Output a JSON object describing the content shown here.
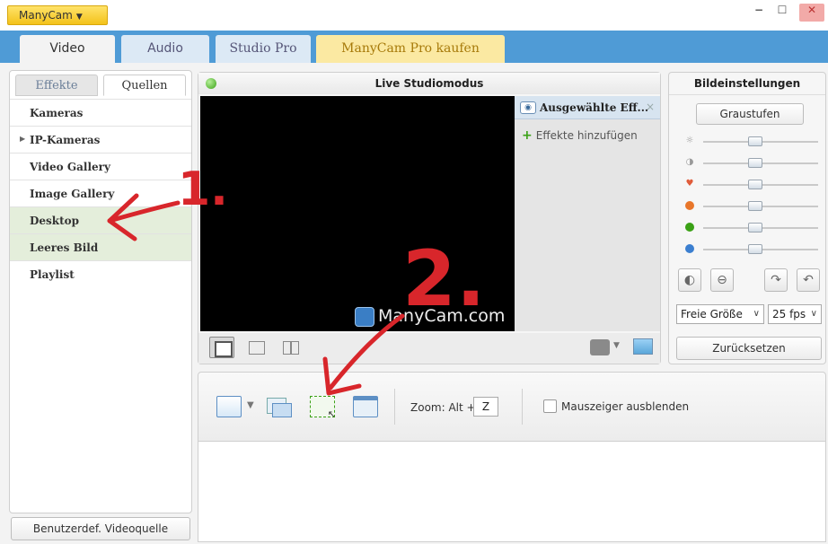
{
  "app": {
    "menu_label": "ManyCam",
    "window_controls": {
      "minimize": "−",
      "maximize": "☐",
      "close": "✕"
    }
  },
  "main_tabs": [
    {
      "label": "Video"
    },
    {
      "label": "Audio"
    },
    {
      "label": "Studio Pro"
    },
    {
      "label": "ManyCam Pro kaufen"
    }
  ],
  "left_panel": {
    "subtabs": [
      {
        "label": "Effekte"
      },
      {
        "label": "Quellen"
      }
    ],
    "items": [
      {
        "label": "Kameras"
      },
      {
        "label": "IP-Kameras"
      },
      {
        "label": "Video Gallery"
      },
      {
        "label": "Image Gallery"
      },
      {
        "label": "Desktop"
      },
      {
        "label": "Leeres Bild"
      },
      {
        "label": "Playlist"
      }
    ],
    "custom_source_button": "Benutzerdef. Videoquelle"
  },
  "live_panel": {
    "title": "Live Studiomodus",
    "watermark": "ManyCam.com",
    "effects_header": "Ausgewählte Eff...",
    "effects_close": "×",
    "add_effects": "Effekte hinzufügen",
    "add_symbol": "+"
  },
  "settings_panel": {
    "title": "Bildeinstellungen",
    "grayscale_button": "Graustufen",
    "size_select": "Freie Größe",
    "fps_select": "25 fps",
    "reset_button": "Zurücksetzen",
    "slider_colors": [
      "#b5b5b5",
      "#b5b5b5",
      "#e05c3a",
      "#e8762a",
      "#3aa116",
      "#3b7fd0"
    ]
  },
  "desktop_toolbar": {
    "zoom_label": "Zoom: Alt +",
    "zoom_key": "Z",
    "hide_cursor_label": "Mauszeiger ausblenden"
  },
  "annotations": {
    "mark_one": "1.",
    "mark_two": "2."
  }
}
